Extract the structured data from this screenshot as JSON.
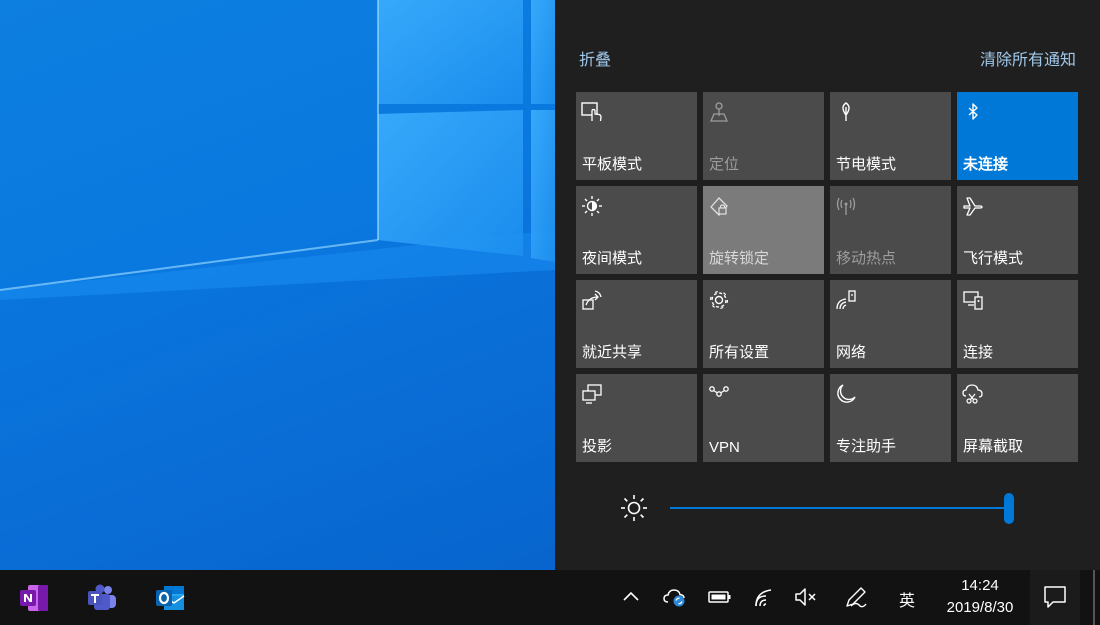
{
  "action_center": {
    "collapse_label": "折叠",
    "clear_all_label": "清除所有通知",
    "tiles": [
      {
        "label": "平板模式",
        "icon": "tablet-mode-icon",
        "state": "normal"
      },
      {
        "label": "定位",
        "icon": "location-icon",
        "state": "disabled"
      },
      {
        "label": "节电模式",
        "icon": "battery-saver-icon",
        "state": "normal"
      },
      {
        "label": "未连接",
        "icon": "bluetooth-icon",
        "state": "active"
      },
      {
        "label": "夜间模式",
        "icon": "night-light-icon",
        "state": "normal"
      },
      {
        "label": "旋转锁定",
        "icon": "rotation-lock-icon",
        "state": "highlighted"
      },
      {
        "label": "移动热点",
        "icon": "mobile-hotspot-icon",
        "state": "disabled"
      },
      {
        "label": "飞行模式",
        "icon": "airplane-mode-icon",
        "state": "normal"
      },
      {
        "label": "就近共享",
        "icon": "nearby-sharing-icon",
        "state": "normal"
      },
      {
        "label": "所有设置",
        "icon": "settings-gear-icon",
        "state": "normal"
      },
      {
        "label": "网络",
        "icon": "network-icon",
        "state": "normal"
      },
      {
        "label": "连接",
        "icon": "connect-icon",
        "state": "normal"
      },
      {
        "label": "投影",
        "icon": "project-icon",
        "state": "normal"
      },
      {
        "label": "VPN",
        "icon": "vpn-icon",
        "state": "normal"
      },
      {
        "label": "专注助手",
        "icon": "focus-assist-icon",
        "state": "normal"
      },
      {
        "label": "屏幕截取",
        "icon": "screen-snip-icon",
        "state": "normal"
      }
    ],
    "brightness": {
      "icon": "brightness-icon",
      "value": 1.0
    }
  },
  "taskbar": {
    "apps": [
      {
        "name": "OneNote",
        "icon": "onenote-icon"
      },
      {
        "name": "Teams",
        "icon": "teams-icon"
      },
      {
        "name": "Outlook",
        "icon": "outlook-icon"
      }
    ],
    "tray_icons": [
      "chevron-up-icon",
      "onedrive-sync-icon",
      "battery-icon",
      "wifi-icon",
      "volume-muted-icon",
      "pen-workspace-icon"
    ],
    "ime_label": "英",
    "time": "14:24",
    "date": "2019/8/30"
  },
  "colors": {
    "accent": "#0078d7",
    "tile": "#4b4b4b",
    "tile_highlight": "#7b7b7b",
    "panel": "#1f1f1f",
    "taskbar": "#121212",
    "link": "#a0c8ea"
  }
}
